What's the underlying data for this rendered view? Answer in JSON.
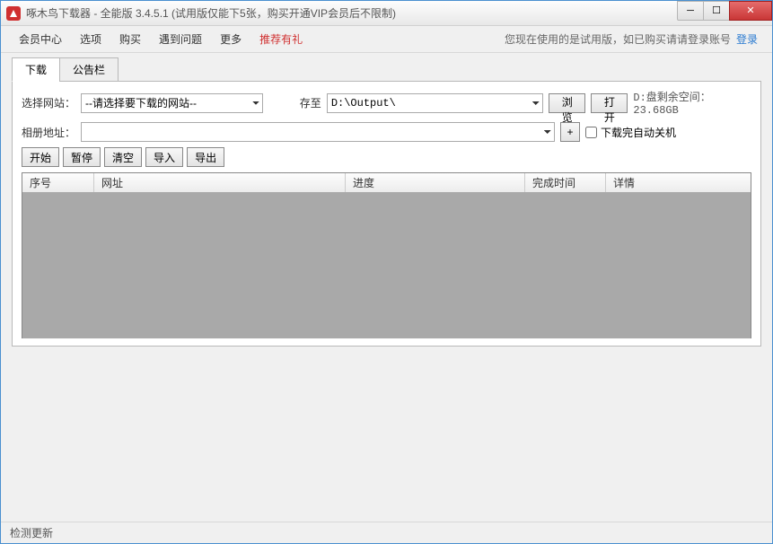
{
  "titlebar": {
    "text": "啄木鸟下载器 - 全能版 3.4.5.1 (试用版仅能下5张，购买开通VIP会员后不限制)"
  },
  "menu": {
    "items": [
      "会员中心",
      "选项",
      "购买",
      "遇到问题",
      "更多"
    ],
    "accent": "推荐有礼",
    "trial_text": "您现在使用的是试用版，如已购买请请登录账号",
    "login": "登录"
  },
  "tabs": {
    "download": "下载",
    "announcement": "公告栏"
  },
  "form": {
    "site_label": "选择网站：",
    "site_placeholder": "--请选择要下载的网站--",
    "save_to_label": "存至",
    "save_to_value": "D:\\Output\\",
    "browse": "浏览",
    "open": "打开",
    "disk_space": "D:盘剩余空间：23.68GB",
    "album_label": "相册地址：",
    "album_value": "",
    "add": "+",
    "auto_shutdown": "下载完自动关机"
  },
  "actions": {
    "start": "开始",
    "pause": "暂停",
    "clear": "清空",
    "import": "导入",
    "export": "导出"
  },
  "columns": {
    "index": "序号",
    "url": "网址",
    "progress": "进度",
    "finish_time": "完成时间",
    "details": "详情"
  },
  "status": {
    "check_update": "检测更新"
  }
}
